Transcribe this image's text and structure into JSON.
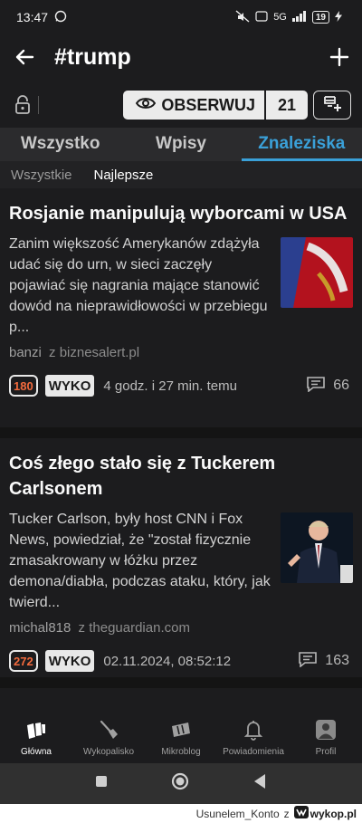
{
  "status_bar": {
    "time": "13:47",
    "network": "5G",
    "battery": "19"
  },
  "app_bar": {
    "title": "#trump",
    "back_icon": "arrow-left-icon",
    "add_icon": "plus-icon"
  },
  "tag_bar": {
    "observe_label": "OBSERWUJ",
    "observers_count": "21"
  },
  "tabs": [
    {
      "label": "Wszystko",
      "active": false
    },
    {
      "label": "Wpisy",
      "active": false
    },
    {
      "label": "Znaleziska",
      "active": true
    }
  ],
  "subtabs": [
    {
      "label": "Wszystkie",
      "active": false
    },
    {
      "label": "Najlepsze",
      "active": true
    }
  ],
  "feed": [
    {
      "title": "Rosjanie manipulują wyborcami w USA",
      "description": "Zanim większość Amerykanów zdążyła udać się do urn, w sieci zaczęły pojawiać się nagrania mające stanowić dowód na nieprawidłowości w przebiegu p...",
      "author": "banzi",
      "source": "z biznesalert.pl",
      "votes": "180",
      "wyko_label": "WYKO",
      "time": "4 godz. i 27 min. temu",
      "comments": "66"
    },
    {
      "title": "Coś złego stało się z Tuckerem Carlsonem",
      "description": "Tucker Carlson, były host CNN i Fox News, powiedział, że \"został fizycznie zmasakrowany w łóżku przez demona/diabła, podczas ataku, który, jak twierd...",
      "author": "michal818",
      "source": "z theguardian.com",
      "votes": "272",
      "wyko_label": "WYKO",
      "time": "02.11.2024, 08:52:12",
      "comments": "163"
    }
  ],
  "bottom_nav": [
    {
      "label": "Główna",
      "icon": "home-logo-icon",
      "active": true
    },
    {
      "label": "Wykopalisko",
      "icon": "shovel-icon",
      "active": false
    },
    {
      "label": "Mikroblog",
      "icon": "microblog-icon",
      "active": false
    },
    {
      "label": "Powiadomienia",
      "icon": "bell-icon",
      "active": false
    },
    {
      "label": "Profil",
      "icon": "user-icon",
      "active": false
    }
  ],
  "footer": {
    "user": "Usunelem_Konto",
    "sep": "z",
    "site": "wykop.pl"
  },
  "colors": {
    "accent": "#3aa0d8",
    "vote": "#f26a3d",
    "background": "#1c1c1e"
  }
}
